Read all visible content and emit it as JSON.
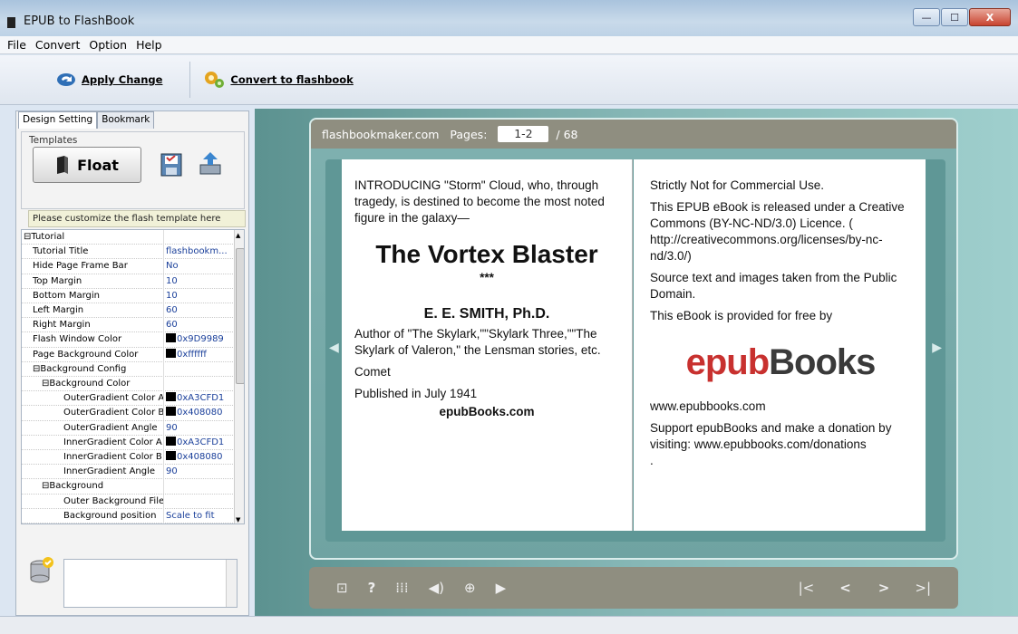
{
  "window": {
    "title": "EPUB to FlashBook",
    "min": "—",
    "max": "☐",
    "close": "X"
  },
  "menu": [
    "File",
    "Convert",
    "Option",
    "Help"
  ],
  "toolbar": {
    "apply": "Apply Change",
    "convert": "Convert to flashbook"
  },
  "tabs": [
    "Design Setting",
    "Bookmark"
  ],
  "templates": {
    "label": "Templates",
    "float": "Float",
    "hint": "Please customize the flash template here"
  },
  "props": [
    {
      "k": "⊟Tutorial",
      "v": "",
      "indent": 0
    },
    {
      "k": "Tutorial Title",
      "v": "flashbookm...",
      "indent": 1
    },
    {
      "k": "Hide Page Frame Bar",
      "v": "No",
      "indent": 1
    },
    {
      "k": "Top Margin",
      "v": "10",
      "indent": 1
    },
    {
      "k": "Bottom Margin",
      "v": "10",
      "indent": 1
    },
    {
      "k": "Left Margin",
      "v": "60",
      "indent": 1
    },
    {
      "k": "Right Margin",
      "v": "60",
      "indent": 1
    },
    {
      "k": "Flash Window Color",
      "v": "0x9D9989",
      "indent": 1,
      "sw": true
    },
    {
      "k": "Page Background Color",
      "v": "0xffffff",
      "indent": 1,
      "sw": true
    },
    {
      "k": "⊟Background Config",
      "v": "",
      "indent": 1
    },
    {
      "k": "⊟Background Color",
      "v": "",
      "indent": 2
    },
    {
      "k": "OuterGradient Color A",
      "v": "0xA3CFD1",
      "indent": 3,
      "sw": true
    },
    {
      "k": "OuterGradient Color B",
      "v": "0x408080",
      "indent": 3,
      "sw": true
    },
    {
      "k": "OuterGradient Angle",
      "v": "90",
      "indent": 3
    },
    {
      "k": "InnerGradient Color A",
      "v": "0xA3CFD1",
      "indent": 3,
      "sw": true
    },
    {
      "k": "InnerGradient Color B",
      "v": "0x408080",
      "indent": 3,
      "sw": true
    },
    {
      "k": "InnerGradient Angle",
      "v": "90",
      "indent": 3
    },
    {
      "k": "⊟Background",
      "v": "",
      "indent": 2
    },
    {
      "k": "Outer Background File",
      "v": "",
      "indent": 3
    },
    {
      "k": "Background position",
      "v": "Scale to fit",
      "indent": 3
    }
  ],
  "preview": {
    "site": "flashbookmaker.com",
    "pages_label": "Pages:",
    "current": "1-2",
    "total": "/ 68"
  },
  "book": {
    "left": {
      "intro": "INTRODUCING \"Storm\" Cloud, who, through tragedy, is destined to become the most noted figure in the galaxy—",
      "title": "The Vortex Blaster",
      "stars": "***",
      "author": "E. E. SMITH, Ph.D.",
      "works": "Author of \"The Skylark,\"\"Skylark Three,\"\"The Skylark of Valeron,\" the Lensman stories, etc.",
      "comet": "Comet",
      "published": "Published in July 1941",
      "site": "epubBooks.com"
    },
    "right": {
      "p1": "Strictly Not for Commercial Use.",
      "p2": "This EPUB eBook is released under a Creative Commons (BY-NC-ND/3.0) Licence. ( http://creativecommons.org/licenses/by-nc-nd/3.0/)",
      "p3": "Source text and images taken from the Public Domain.",
      "p4": "This eBook is provided for free by",
      "logo_a": "epub",
      "logo_b": "Books",
      "url": "www.epubbooks.com",
      "p5": "Support epubBooks and make a donation by visiting: www.epubbooks.com/donations",
      "p6": "."
    }
  },
  "colors": {
    "accent": "#8f8e80",
    "logo_red": "#c8312f",
    "logo_gray": "#3a3a3a"
  }
}
